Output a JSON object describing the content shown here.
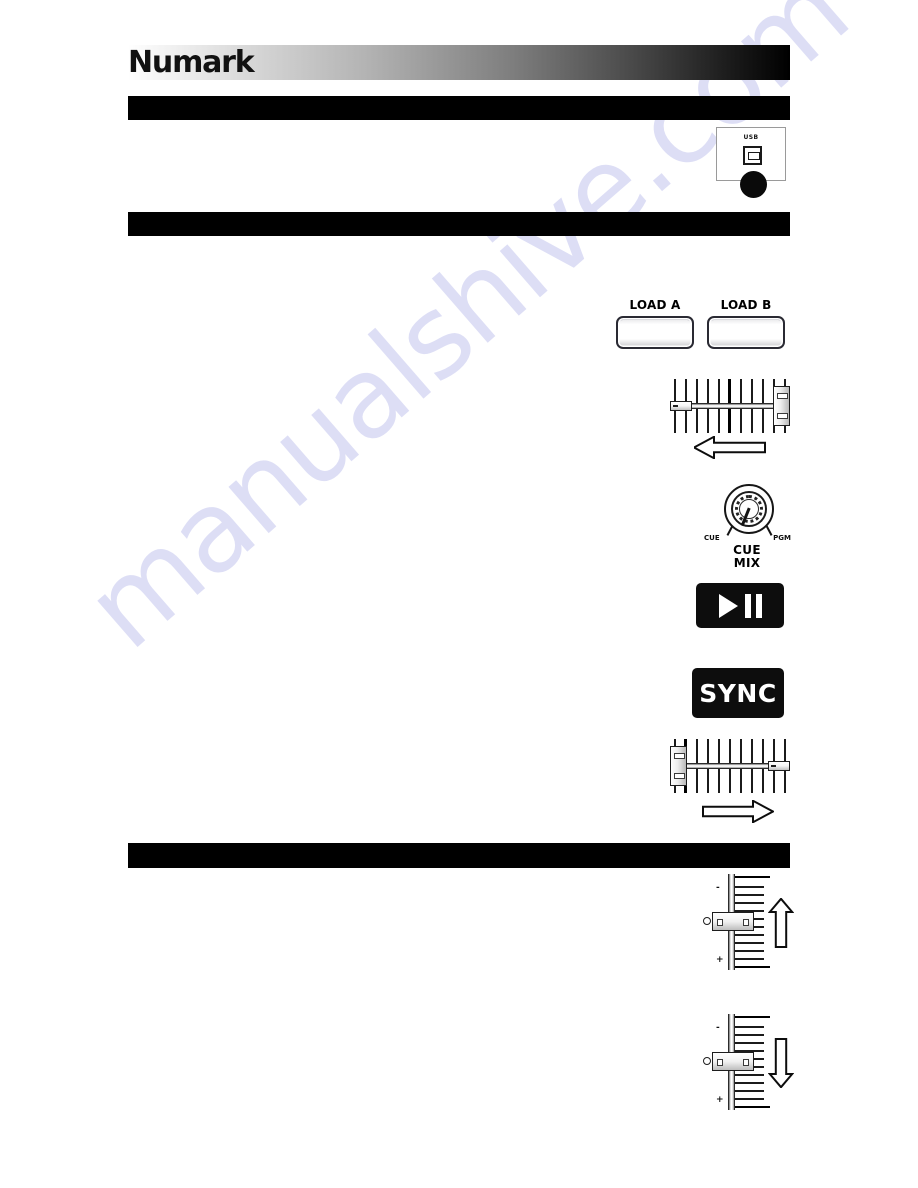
{
  "brand": {
    "logo_text": "Numark"
  },
  "watermark": {
    "text": "manualshive.com"
  },
  "sections": [
    {
      "id": "section-bar-1",
      "label": ""
    },
    {
      "id": "section-bar-2",
      "label": ""
    },
    {
      "id": "section-bar-3",
      "label": ""
    }
  ],
  "figures": {
    "usb": {
      "name": "usb-jack-panel",
      "port_label": "USB"
    },
    "load_buttons": {
      "name": "load-buttons",
      "buttons": [
        {
          "label": "LOAD A"
        },
        {
          "label": "LOAD B"
        }
      ]
    },
    "crossfader_left": {
      "name": "crossfader-move-left",
      "direction": "left",
      "tick_count": 11,
      "handle_position": "right"
    },
    "crossfader_right": {
      "name": "crossfader-move-right",
      "direction": "right",
      "tick_count": 11,
      "handle_position": "left"
    },
    "cue_mix_knob": {
      "name": "cue-mix-knob",
      "min_label": "CUE",
      "max_label": "PGM",
      "caption_line1": "CUE",
      "caption_line2": "MIX"
    },
    "play_pause": {
      "name": "play-pause-button",
      "icon": "play-pause-icon"
    },
    "sync": {
      "name": "sync-button",
      "label": "SYNC"
    },
    "fader_up": {
      "name": "pitch-fader-up",
      "direction": "up",
      "top_label": "-",
      "bottom_label": "+",
      "tick_count": 13
    },
    "fader_down": {
      "name": "pitch-fader-down",
      "direction": "down",
      "top_label": "-",
      "bottom_label": "+",
      "tick_count": 13
    }
  },
  "colors": {
    "bar_black": "#000000",
    "button_black": "#0d0d0d",
    "watermark": "#c9cbf0",
    "paper": "#ffffff"
  }
}
